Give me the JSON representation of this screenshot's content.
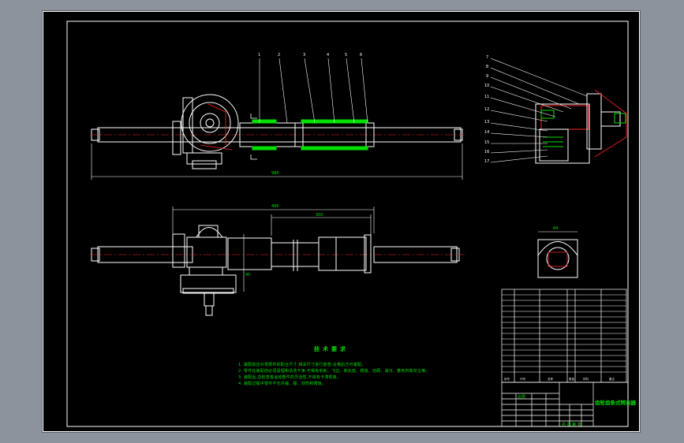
{
  "drawing": {
    "sheet_background": "#000000",
    "line_color": "#ffffff",
    "text_color": "#00e000",
    "accent_red": "#ff2020",
    "accent_green": "#00e000"
  },
  "technical_requirements": {
    "title": "技术要求",
    "lines": [
      "1. 装配前应对零部件的配合尺寸,相关尺寸进行复查,合格后方可装配。",
      "2. 零件在装配前必须清理和清洗干净,不得有毛刺、飞边、氧化皮、锈蚀、切屑、油污、着色剂和灰尘等。",
      "3. 装配后,应检查各运动部件的灵活性,不得有卡滞现象。",
      "4. 装配过程中零件不允许磕、碰、划伤和锈蚀。"
    ]
  },
  "title_block": {
    "drawing_name": "齿轮齿条式转向器",
    "scale_label": "比例",
    "sheet_label": "共 张 第 张"
  },
  "callouts": {
    "top_view": [
      "1",
      "2",
      "3",
      "4",
      "5",
      "6"
    ],
    "section_view": [
      "7",
      "8",
      "9",
      "10",
      "11",
      "12",
      "13",
      "14",
      "15",
      "16",
      "17"
    ]
  },
  "dimensions": {
    "overall_length": "980",
    "middle_length": "490",
    "inner_length": "300",
    "vertical": "95",
    "section_width": "64"
  },
  "bom_header": [
    "序号",
    "代号",
    "名称",
    "数量",
    "材料",
    "备注"
  ]
}
